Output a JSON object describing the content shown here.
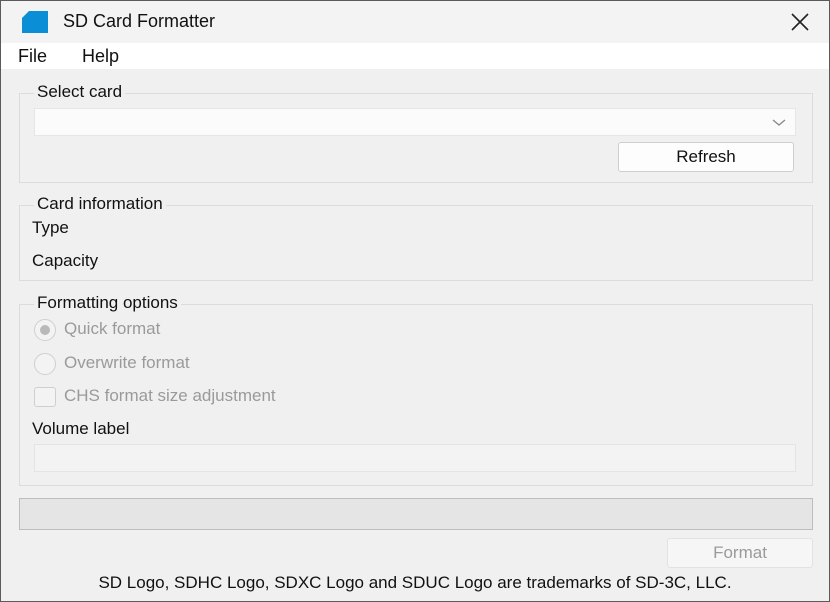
{
  "window": {
    "title": "SD Card Formatter",
    "icon": "sd-card-icon",
    "accent": "#0A8FD6"
  },
  "menu": {
    "file": "File",
    "help": "Help"
  },
  "select_card": {
    "legend": "Select card",
    "selected": "",
    "refresh_label": "Refresh"
  },
  "card_info": {
    "legend": "Card information",
    "type_label": "Type",
    "capacity_label": "Capacity"
  },
  "formatting": {
    "legend": "Formatting options",
    "quick_format": "Quick format",
    "overwrite_format": "Overwrite format",
    "chs_adjust": "CHS format size adjustment",
    "volume_label": "Volume label",
    "volume_value": ""
  },
  "progress": {
    "value": 0
  },
  "actions": {
    "format_label": "Format"
  },
  "footer": {
    "trademark": "SD Logo, SDHC Logo, SDXC Logo and SDUC Logo are trademarks of SD-3C, LLC."
  }
}
